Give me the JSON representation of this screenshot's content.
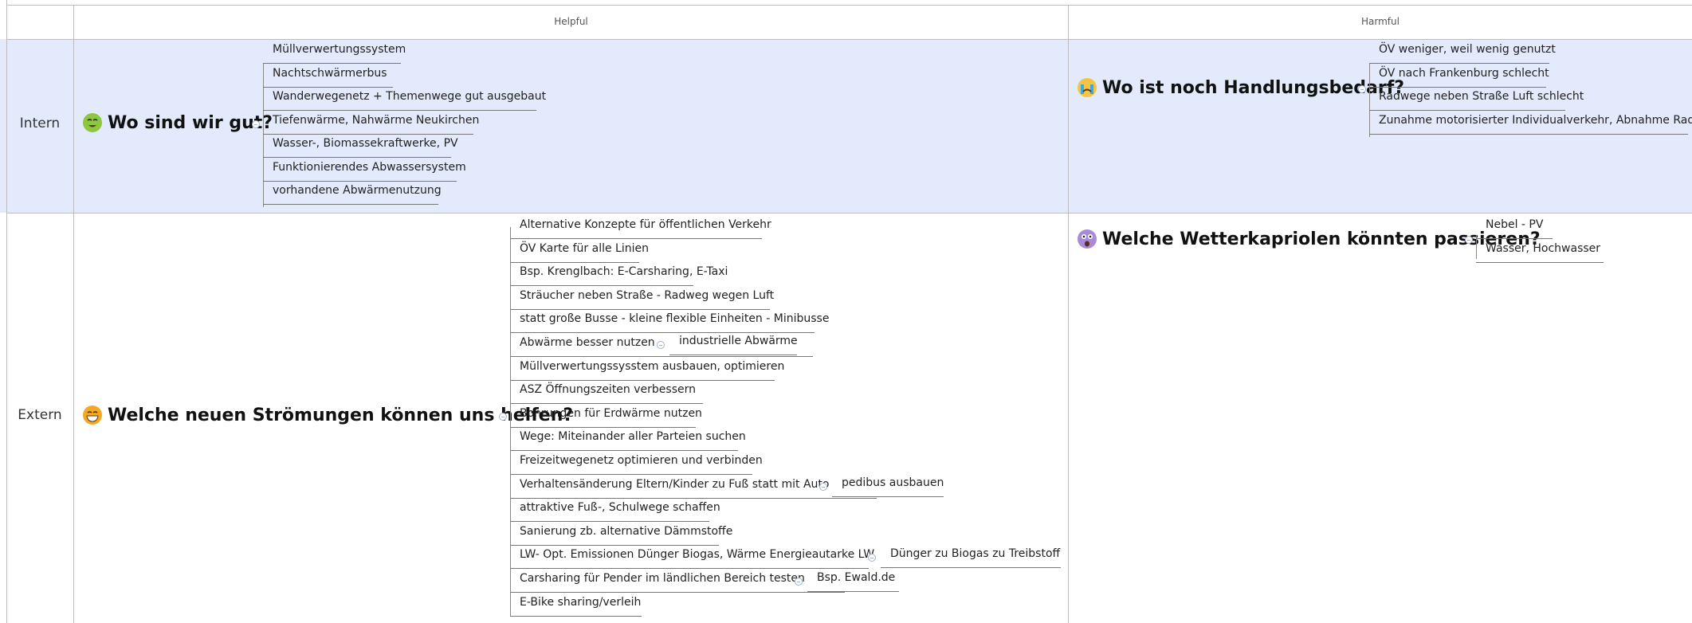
{
  "columns": {
    "helpful": "Helpful",
    "harmful": "Harmful"
  },
  "rows": {
    "intern": "Intern",
    "extern": "Extern"
  },
  "colors": {
    "intern_band": "#e3eafc",
    "grid": "#bcbcbc"
  },
  "quadrants": {
    "intern_helpful": {
      "title": "Wo sind wir gut?",
      "icon": "nauseated-face-icon",
      "items": [
        "Müllverwertungssystem",
        "Nachtschwärmerbus",
        "Wanderwegenetz + Themenwege gut ausgebaut",
        "Tiefenwärme, Nahwärme Neukirchen",
        "Wasser-, Biomassekraftwerke, PV",
        "Funktionierendes Abwassersystem",
        "vorhandene Abwärmenutzung"
      ]
    },
    "intern_harmful": {
      "title": "Wo ist noch Handlungsbedarf?",
      "icon": "crying-face-icon",
      "items": [
        "ÖV weniger, weil wenig genutzt",
        "ÖV nach Frankenburg schlecht",
        "Radwege neben Straße Luft schlecht",
        "Zunahme motorisierter Individualverkehr, Abnahme Rad"
      ]
    },
    "extern_helpful": {
      "title": "Welche neuen Strömungen können uns helfen?",
      "icon": "grinning-face-icon",
      "items": [
        "Alternative Konzepte für öffentlichen Verkehr",
        "ÖV Karte für alle Linien",
        "Bsp. Krenglbach: E-Carsharing, E-Taxi",
        "Sträucher neben Straße - Radweg wegen Luft",
        "statt große Busse - kleine flexible Einheiten - Minibusse",
        "Abwärme besser nutzen",
        "Müllverwertungssysstem ausbauen, optimieren",
        "ASZ Öffnungszeiten verbessern",
        "Bohrungen für Erdwärme nutzen",
        "Wege: Miteinander aller Parteien suchen",
        "Freizeitwegenetz optimieren und verbinden",
        "Verhaltensänderung Eltern/Kinder zu Fuß statt mit Auto",
        "attraktive Fuß-, Schulwege schaffen",
        "Sanierung zb. alternative Dämmstoffe",
        "LW- Opt. Emissionen Dünger Biogas, Wärme Energieautarke LW",
        "Carsharing für Pender im ländlichen Bereich testen",
        "E-Bike sharing/verleih"
      ],
      "subitems": {
        "abwaerme": "industrielle Abwärme",
        "pedibus": "pedibus ausbauen",
        "duenger": "Dünger zu Biogas zu Treibstoff",
        "ewald": "Bsp. Ewald.de"
      }
    },
    "extern_harmful": {
      "title": "Welche Wetterkapriolen könnten passieren?",
      "icon": "astonished-face-icon",
      "items": [
        "Nebel - PV",
        "Wasser, Hochwasser"
      ]
    }
  }
}
